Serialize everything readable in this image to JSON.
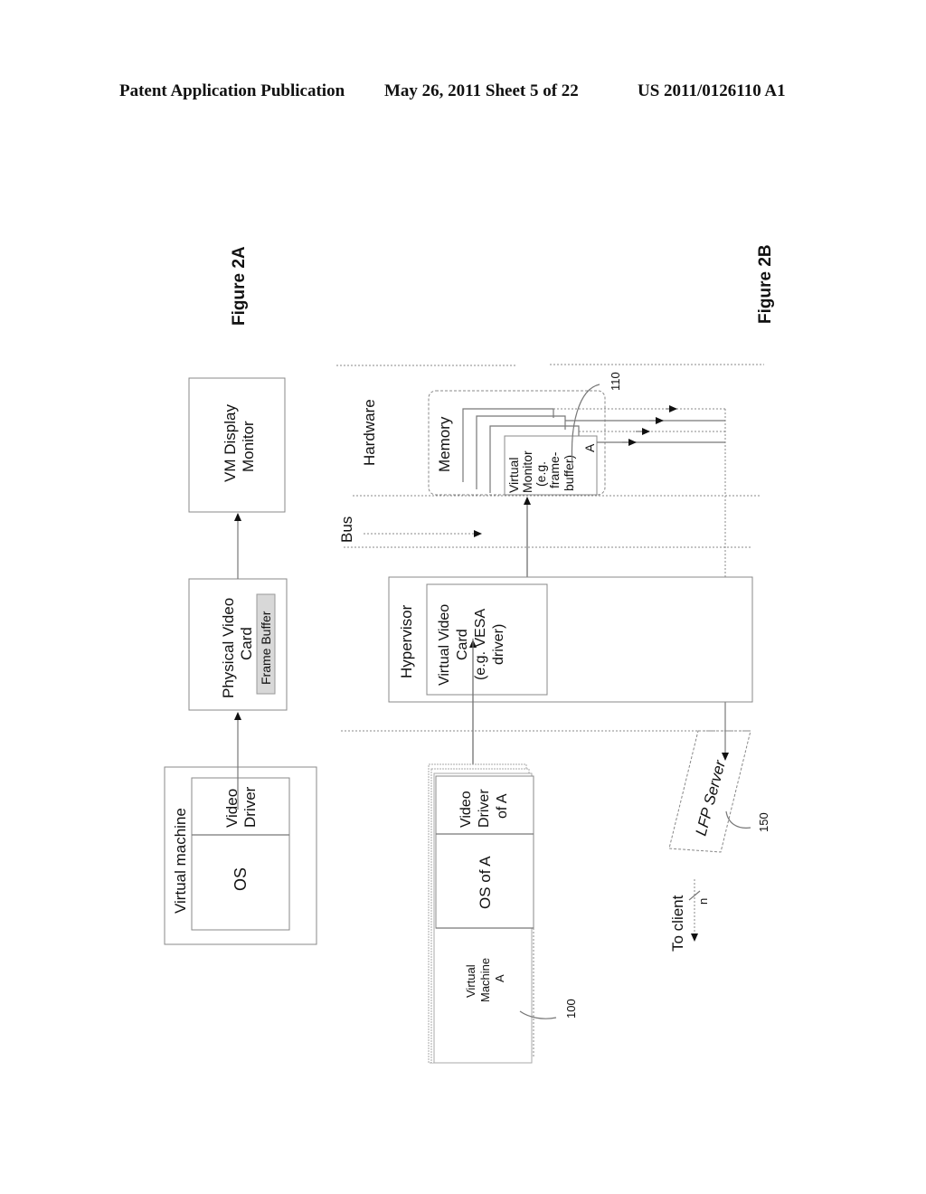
{
  "header": {
    "publication": "Patent Application Publication",
    "date_sheet": "May 26, 2011   Sheet 5 of 22",
    "number": "US 2011/0126110 A1"
  },
  "figure_2a": {
    "caption": "Figure 2A",
    "virtual_machine": {
      "title": "Virtual machine",
      "os": "OS",
      "video_driver": [
        "Video",
        "Driver"
      ]
    },
    "physical_video_card": {
      "title": [
        "Physical Video",
        "Card"
      ],
      "frame_buffer": "Frame Buffer"
    },
    "display_monitor": [
      "VM Display",
      "Monitor"
    ]
  },
  "figure_2b": {
    "caption": "Figure 2B",
    "hardware_label": "Hardware",
    "memory_label": "Memory",
    "virtual_monitor": [
      "Virtual",
      "Monitor",
      "(e.g.",
      "frame-",
      "buffer)",
      "A"
    ],
    "ref_110": "110",
    "bus_label": "Bus",
    "hypervisor_label": "Hypervisor",
    "virtual_video_card": [
      "Virtual Video",
      "Card",
      "(e.g. VESA",
      "driver)"
    ],
    "vm_a": {
      "video_driver": [
        "Video",
        "Driver",
        "of A"
      ],
      "os": "OS of A",
      "machine": [
        "Virtual",
        "Machine",
        "A"
      ]
    },
    "ref_100": "100",
    "lfp_server": "LFP Server",
    "ref_150": "150",
    "to_client": "To client",
    "n_label": "n"
  }
}
